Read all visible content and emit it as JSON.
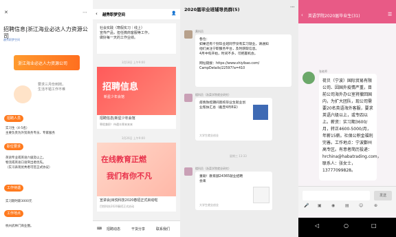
{
  "panel1": {
    "title": "招聘信息|浙江海业必达人力资源公司",
    "source": "越秀职梦空间",
    "banner": "浙江海业必达人力资源公司",
    "slogan_line1": "要求三月份到岗，",
    "slogan_line2": "生活不错工作不难",
    "sections": [
      {
        "badge": "招聘人员",
        "body": "实习生（4-5名）\n主要负责为外贸商务专员、专家服务"
      },
      {
        "badge": "职位要求",
        "body": "英语专业或英语六级及以上。\n物流或英语口语突出者优先。\n（实习表现优秀者可签正式协议）"
      },
      {
        "badge": "工作待遇",
        "body": "实习期时薪3000元"
      },
      {
        "badge": "工作地点",
        "body": "杭州武林门商业圈。"
      }
    ]
  },
  "panel2": {
    "header": "越秀职梦空间",
    "top_text": "社会实践（寒假实习｜线上）\n宣传产品，担任微商客服等工作，\n做好每一天的工作业绩。",
    "date1": "3月18日 上午9:00",
    "card1_label": "招聘信息",
    "card1_sub": "新星少年会馆",
    "card1_caption": "招聘信息|新星少年会馆",
    "card1_small": "寒假兼职！待遇丰厚来来来",
    "date2": "3月26日 上午9:00",
    "card2_label_top": "在线教育正燃",
    "card2_label_bottom": "我们有你不凡",
    "card2_caption": "宣讲会|目悦科技2020春招正式启动啦",
    "card2_small": "目悦科技2020春招正式启动",
    "nav": [
      "招聘动态",
      "干货分享",
      "联系我们"
    ]
  },
  "panel3": {
    "title": "2020届毕业班辅导员群(5)",
    "sender1": "黄科员",
    "msg1": "各位：\n如果还有个别毕业班同学没有实习就业，请通知\n他们关注宁职服务平台，及时获取信息。\n4月中旬开始，时间不多，可把握机会。\n\n网址链接：https://www.shiyibao.com/\nCampDetails/22597?a=410",
    "sender2": "楼科员（浙菜学院就业研究）",
    "card_title": "疫情防控期间高校毕业生就业创\n业帮扶汇总（截至4月8日）",
    "card_from": "大学生就业创业",
    "date": "星期三 13:33",
    "sender3": "楼科员（浙菜学院就业研究）",
    "card2_title": "重磅！教育部24365就业招聘\n会来",
    "card2_from": "大学生就业创业"
  },
  "panel4": {
    "title": "英语学院2020届毕业生(31)",
    "sender": "张老师",
    "message": "荷贝（宁波）国际贸易有限公司、因国外疫情严重，目前公司海外办公室将撤回国内，为扩大团队，现公司需要20名英语海外客服，要求英语六级以上，或专四以上。薪资：实习期3600/月，转正4600-5000/月，年薪15薪。社保公积金福利完善。工作地点：宁波鄞州高专区。有意者简历投递：hrchina@habatrading.com，联系人：张女士，13777099828。",
    "send_label": "发送"
  },
  "colors": {
    "orange": "#ff7a1e",
    "pink_header": "#e85a86",
    "link": "#3a6ed0"
  }
}
